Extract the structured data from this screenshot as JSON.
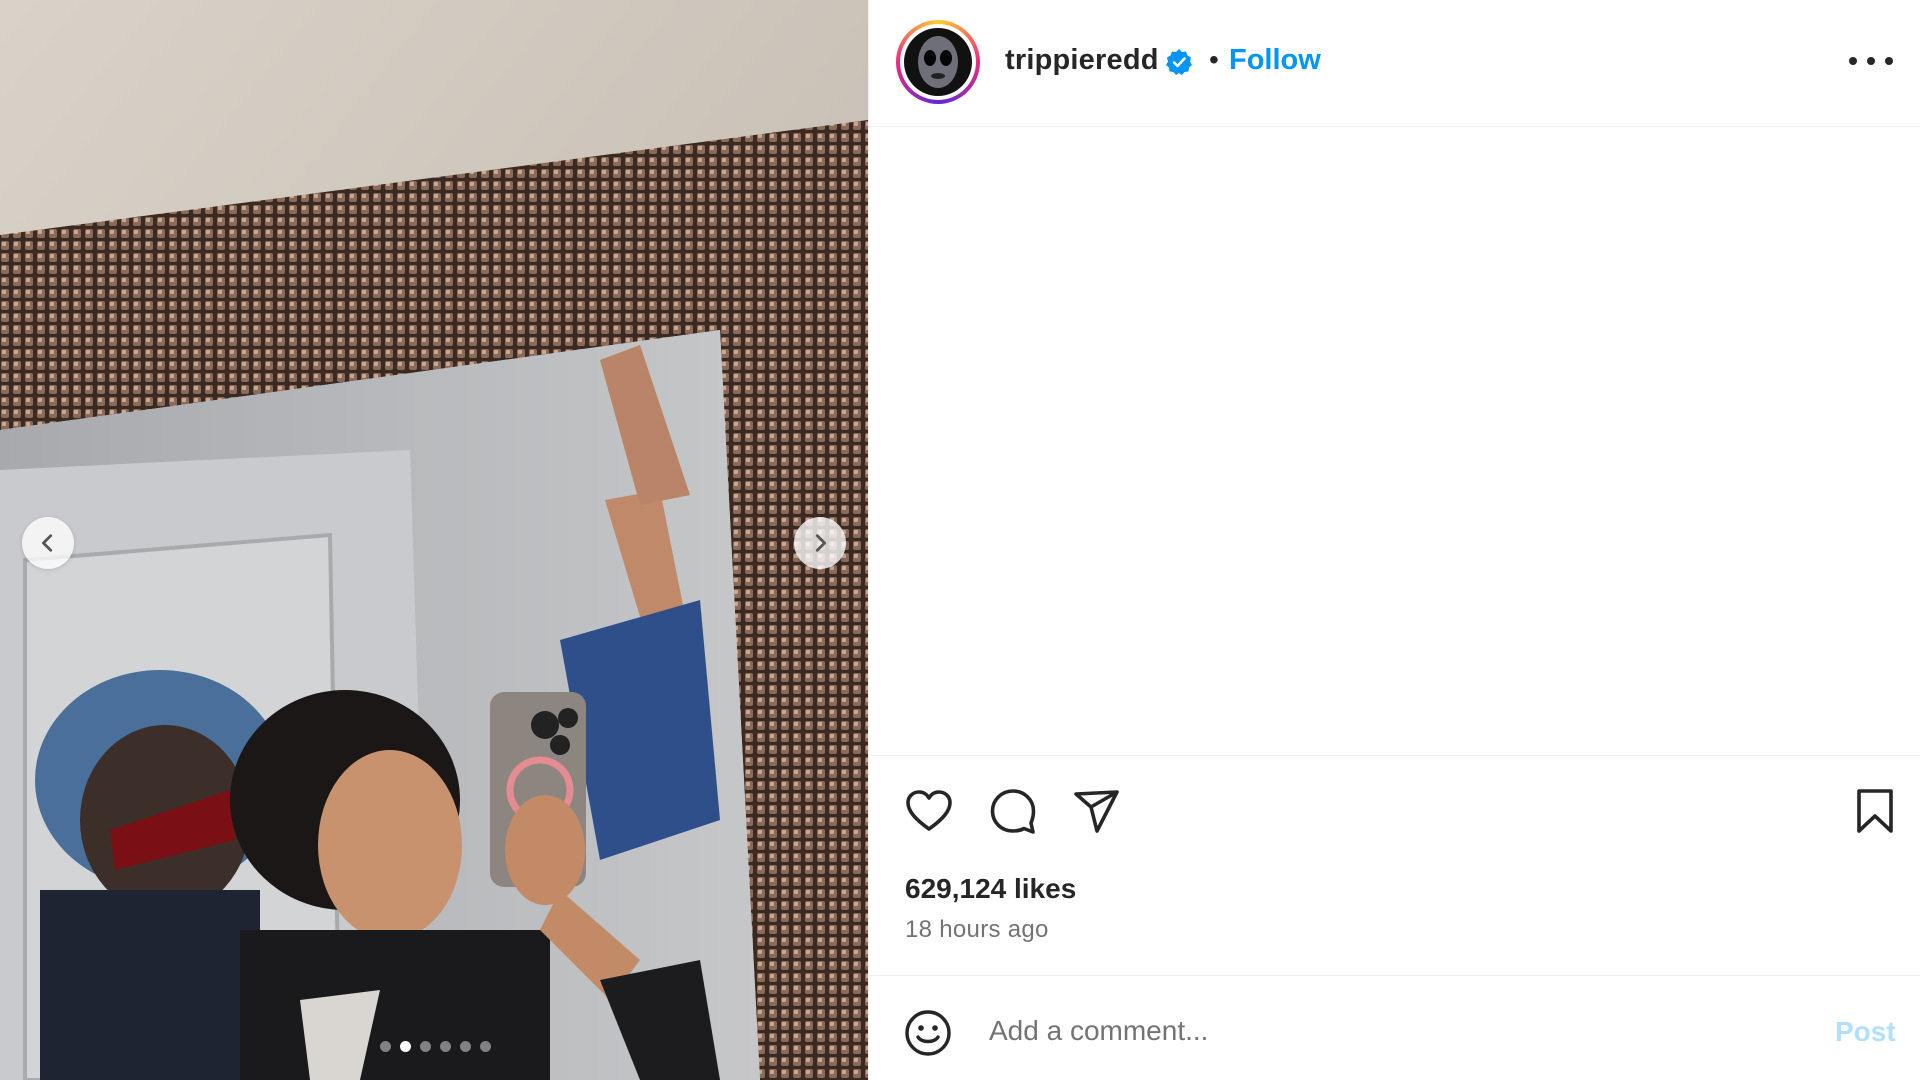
{
  "post": {
    "username": "trippieredd",
    "verified": true,
    "separator": "•",
    "follow_label": "Follow",
    "likes_text": "629,124 likes",
    "time_text": "18 hours ago",
    "carousel_total": 6,
    "carousel_active": 2
  },
  "comment_bar": {
    "placeholder": "Add a comment...",
    "post_label": "Post"
  },
  "icons": {
    "like": "heart-icon",
    "comment": "comment-bubble-icon",
    "share": "paper-plane-icon",
    "save": "bookmark-icon",
    "emoji": "smiley-icon",
    "more": "more-options-icon",
    "prev": "chevron-left-icon",
    "next": "chevron-right-icon",
    "verified": "verified-badge-icon"
  },
  "colors": {
    "follow": "#0095f6",
    "post_disabled": "#b2dffc",
    "verified": "#0095f6",
    "text": "#262626",
    "muted": "#737373"
  }
}
